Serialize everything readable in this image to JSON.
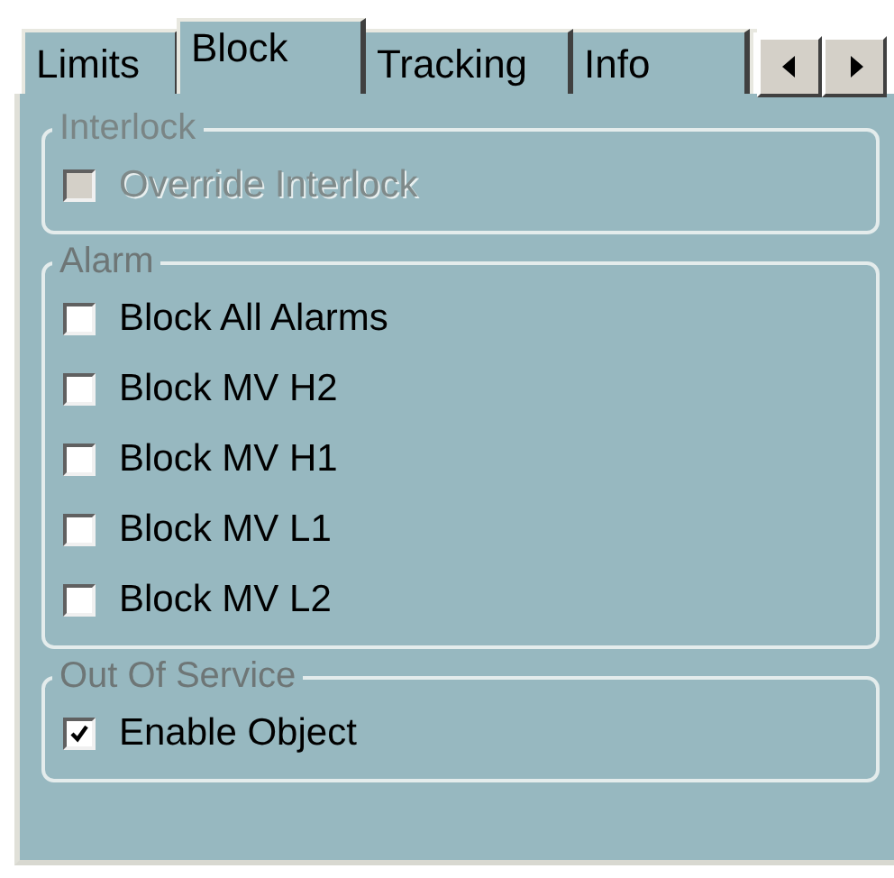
{
  "tabs": [
    {
      "label": "Limits",
      "selected": false
    },
    {
      "label": "Block",
      "selected": true
    },
    {
      "label": "Tracking",
      "selected": false
    },
    {
      "label": "Info",
      "selected": false
    }
  ],
  "groups": [
    {
      "title": "Interlock",
      "disabled": true,
      "items": [
        {
          "label": "Override Interlock",
          "checked": false,
          "disabled": true
        }
      ]
    },
    {
      "title": "Alarm",
      "disabled": false,
      "items": [
        {
          "label": "Block All Alarms",
          "checked": false,
          "disabled": false
        },
        {
          "label": "Block MV H2",
          "checked": false,
          "disabled": false
        },
        {
          "label": "Block MV H1",
          "checked": false,
          "disabled": false
        },
        {
          "label": "Block MV L1",
          "checked": false,
          "disabled": false
        },
        {
          "label": "Block MV L2",
          "checked": false,
          "disabled": false
        }
      ]
    },
    {
      "title": "Out Of Service",
      "disabled": false,
      "items": [
        {
          "label": "Enable Object",
          "checked": true,
          "disabled": false
        }
      ]
    }
  ]
}
